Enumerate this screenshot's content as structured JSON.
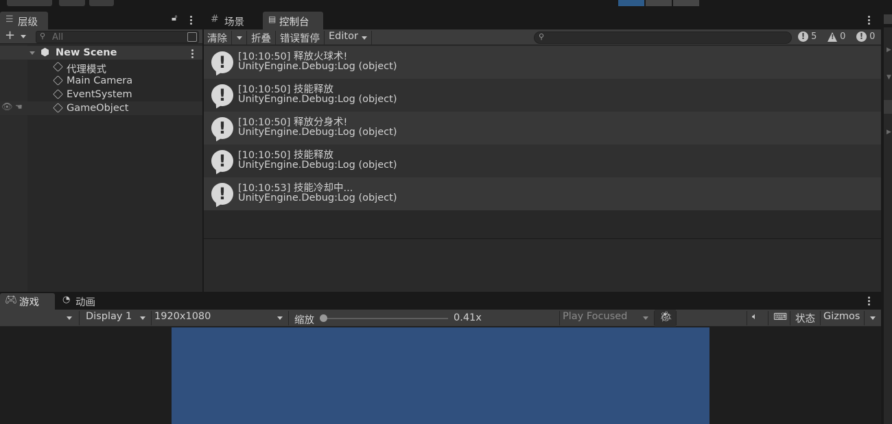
{
  "hierarchy": {
    "tab_label": "层级",
    "search_placeholder": "All",
    "scene_name": "New Scene",
    "objects": [
      "代理模式",
      "Main Camera",
      "EventSystem",
      "GameObject"
    ]
  },
  "console": {
    "tabs": [
      "场景",
      "控制台"
    ],
    "toolbar": {
      "clear": "清除",
      "collapse": "折叠",
      "error_pause": "错误暂停",
      "editor": "Editor",
      "log_count": "5",
      "warning_count": "0",
      "error_count": "0"
    },
    "logs": [
      {
        "message": "[10:10:50] 释放火球术!",
        "source": "UnityEngine.Debug:Log (object)"
      },
      {
        "message": "[10:10:50] 技能释放",
        "source": "UnityEngine.Debug:Log (object)"
      },
      {
        "message": "[10:10:50] 释放分身术!",
        "source": "UnityEngine.Debug:Log (object)"
      },
      {
        "message": "[10:10:50] 技能释放",
        "source": "UnityEngine.Debug:Log (object)"
      },
      {
        "message": "[10:10:53] 技能冷却中...",
        "source": "UnityEngine.Debug:Log (object)"
      }
    ]
  },
  "game": {
    "tabs": [
      "游戏",
      "动画"
    ],
    "display": "Display 1",
    "resolution": "1920x1080",
    "scale_label": "缩放",
    "scale_value": "0.41x",
    "play_mode": "Play Focused",
    "stats": "状态",
    "gizmos": "Gizmos"
  },
  "colors": {
    "panel_bg": "#282828",
    "toolbar_bg": "#3c3c3c",
    "game_screen": "#30507e",
    "play_active": "#2d5b8a"
  }
}
